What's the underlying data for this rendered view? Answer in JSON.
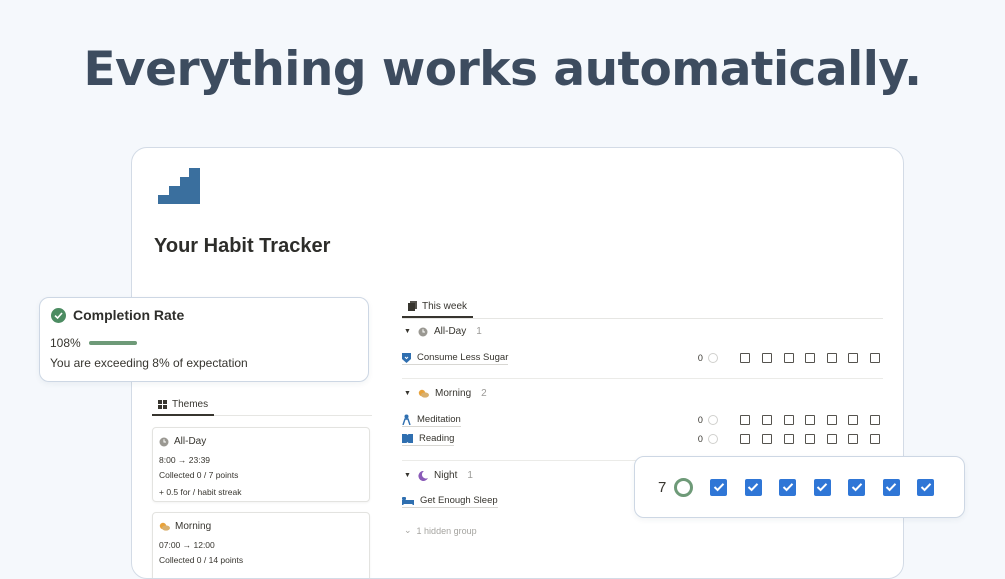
{
  "headline": "Everything works automatically.",
  "page": {
    "title": "Your Habit Tracker"
  },
  "themes_tab": {
    "label": "Themes",
    "cards": [
      {
        "name": "All-Day",
        "icon": "clock-icon",
        "time": "8:00 → 23:39",
        "collected": "Collected 0 / 7 points",
        "bonus": "+ 0.5 for / habit streak"
      },
      {
        "name": "Morning",
        "icon": "sun-cloud-icon",
        "time": "07:00 → 12:00",
        "collected": "Collected 0 / 14 points"
      }
    ]
  },
  "week_tab": {
    "label": "This week",
    "groups": [
      {
        "name": "All-Day",
        "icon": "clock-icon",
        "count": "1",
        "habits": [
          {
            "name": "Consume Less Sugar",
            "icon": "shield-icon",
            "value": "0"
          }
        ]
      },
      {
        "name": "Morning",
        "icon": "sun-cloud-icon",
        "count": "2",
        "habits": [
          {
            "name": "Meditation",
            "icon": "meditation-icon",
            "value": "0"
          },
          {
            "name": "Reading",
            "icon": "book-icon",
            "value": "0"
          }
        ]
      },
      {
        "name": "Night",
        "icon": "moon-icon",
        "count": "1",
        "habits": [
          {
            "name": "Get Enough Sleep",
            "icon": "bed-icon"
          }
        ]
      }
    ],
    "hidden_group": "1 hidden group"
  },
  "completion": {
    "title": "Completion Rate",
    "percent": "108%",
    "progress_fraction": 1.0,
    "message": "You are exceeding 8% of expectation"
  },
  "streak": {
    "value": "7",
    "checked_days": 7
  },
  "colors": {
    "background": "#f5f8fc",
    "headline": "#3d4c5f",
    "accent_green": "#6e9a78",
    "check_blue": "#2f76d6",
    "stairs_icon": "#3a6f9e"
  }
}
